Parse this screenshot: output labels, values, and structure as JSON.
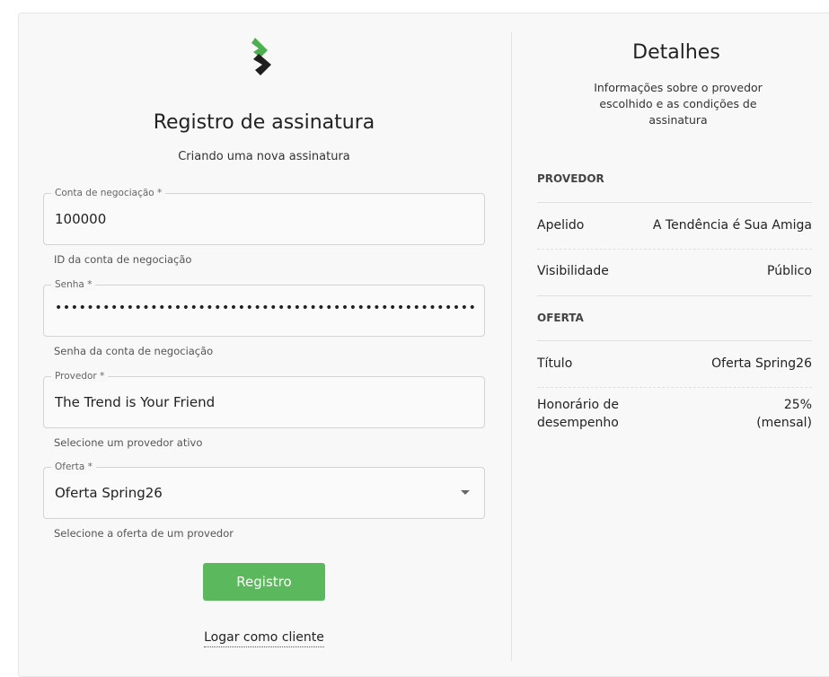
{
  "form": {
    "title": "Registro de assinatura",
    "subtitle": "Criando uma nova assinatura",
    "account": {
      "label": "Conta de negociação *",
      "value": "100000",
      "helper": "ID da conta de negociação"
    },
    "password": {
      "label": "Senha *",
      "value": "••••••••••••••••••••••••••••••••••••••••••••••••••••••••••••",
      "helper": "Senha da conta de negociação"
    },
    "provider": {
      "label": "Provedor *",
      "value": "The Trend is Your Friend",
      "helper": "Selecione um provedor ativo"
    },
    "offer": {
      "label": "Oferta *",
      "value": "Oferta Spring26",
      "helper": "Selecione a oferta de um provedor"
    },
    "submit_label": "Registro",
    "client_login_label": "Logar como cliente"
  },
  "details": {
    "title": "Detalhes",
    "subtitle": "Informações sobre o provedor escolhido e as condições de assinatura",
    "provider_section": "PROVEDOR",
    "nickname_key": "Apelido",
    "nickname_value": "A Tendência é Sua Amiga",
    "visibility_key": "Visibilidade",
    "visibility_value": "Público",
    "offer_section": "OFERTA",
    "title_key": "Título",
    "title_value": "Oferta Spring26",
    "fee_key_line1": "Honorário de",
    "fee_key_line2": "desempenho",
    "fee_value_line1": "25%",
    "fee_value_line2": "(mensal)"
  },
  "colors": {
    "accent_green": "#5cb85c",
    "logo_green": "#4caf50",
    "logo_dark": "#1e1e1e"
  },
  "icons": {
    "logo": "chevron-logo-icon",
    "caret": "caret-down-icon"
  }
}
